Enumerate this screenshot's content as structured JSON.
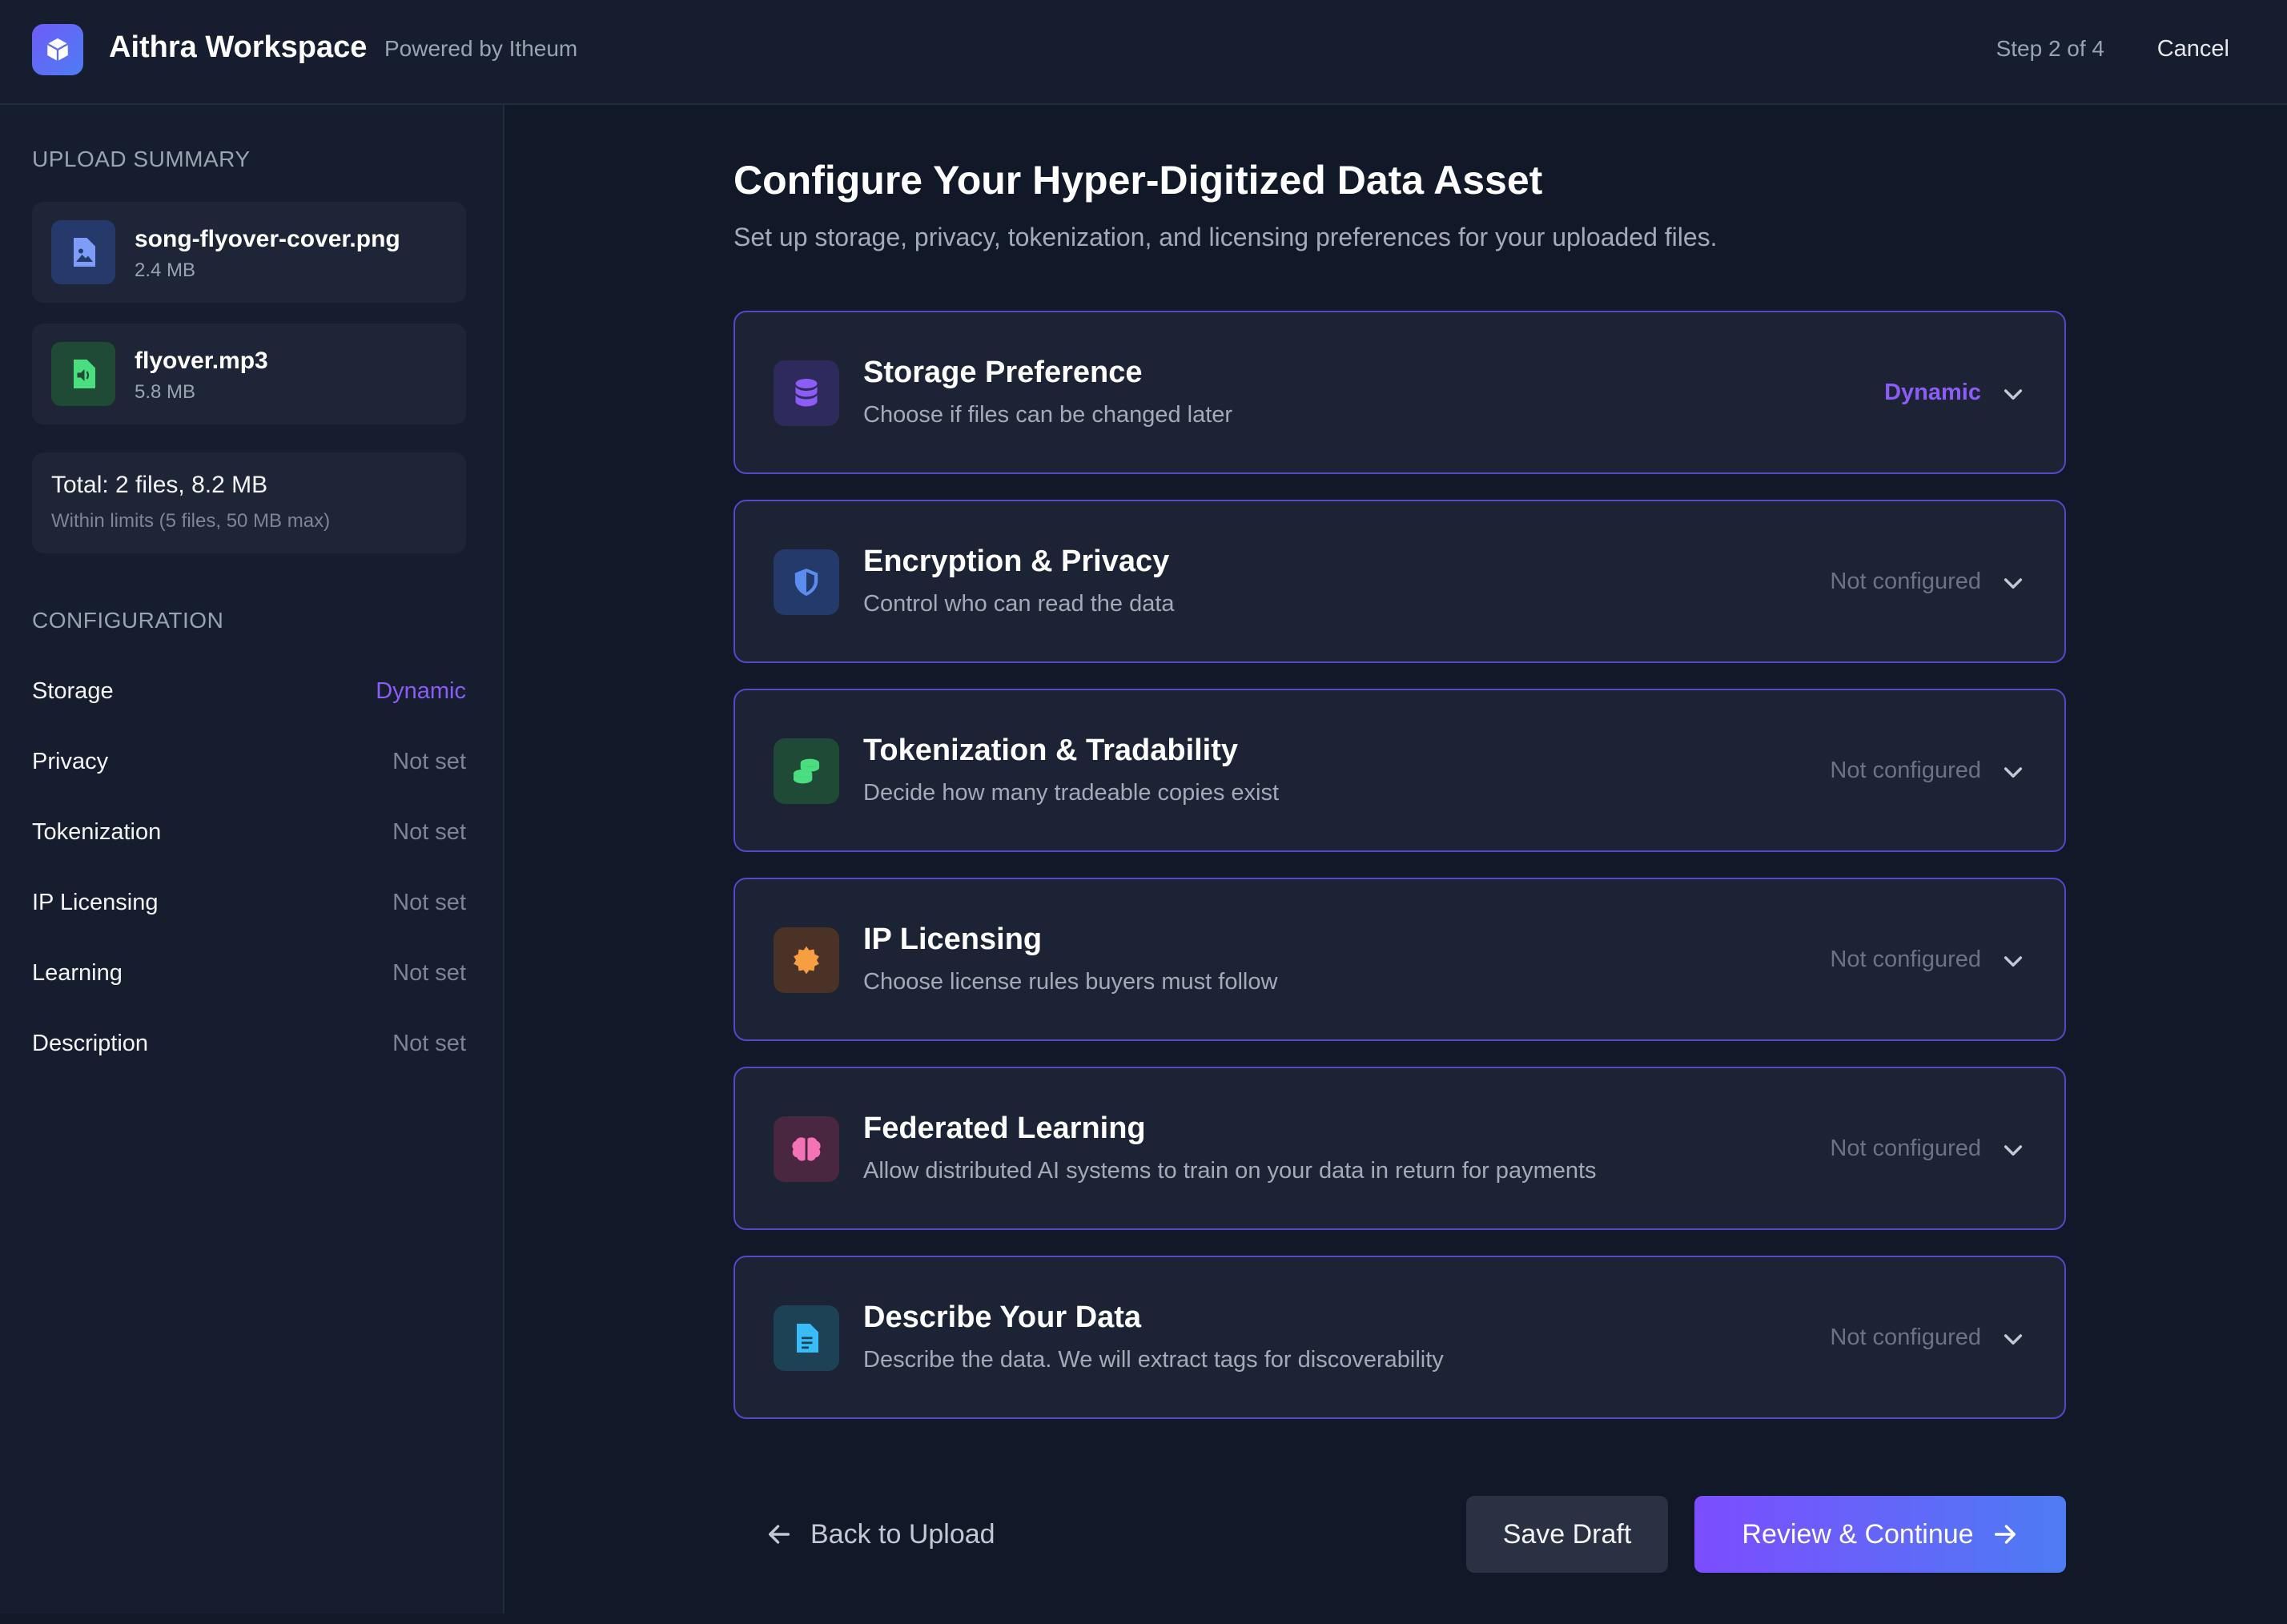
{
  "header": {
    "app_title": "Aithra Workspace",
    "powered_by": "Powered by Itheum",
    "step": "Step 2 of 4",
    "cancel_label": "Cancel",
    "logo_icon": "cube-icon"
  },
  "sidebar": {
    "upload_title": "UPLOAD SUMMARY",
    "files": [
      {
        "name": "song-flyover-cover.png",
        "size": "2.4 MB",
        "icon": "image-file-icon",
        "color": "#6f8cf6"
      },
      {
        "name": "flyover.mp3",
        "size": "5.8 MB",
        "icon": "audio-file-icon",
        "color": "#4ade80"
      }
    ],
    "total": "Total: 2 files, 8.2 MB",
    "limits": "Within limits (5 files, 50 MB max)",
    "config_title": "CONFIGURATION",
    "config": [
      {
        "label": "Storage",
        "value": "Dynamic"
      },
      {
        "label": "Privacy",
        "value": "Not set"
      },
      {
        "label": "Tokenization",
        "value": "Not set"
      },
      {
        "label": "IP Licensing",
        "value": "Not set"
      },
      {
        "label": "Learning",
        "value": "Not set"
      },
      {
        "label": "Description",
        "value": "Not set"
      }
    ]
  },
  "main": {
    "title": "Configure Your Hyper-Digitized Data Asset",
    "subtitle": "Set up storage, privacy, tokenization, and licensing preferences for your uploaded files.",
    "cards": [
      {
        "title": "Storage Preference",
        "desc": "Choose if files can be changed later",
        "status": "Dynamic",
        "icon": "database-icon",
        "color": "#8b5cf6"
      },
      {
        "title": "Encryption & Privacy",
        "desc": "Control who can read the data",
        "status": "Not configured",
        "icon": "shield-icon",
        "color": "#5b8def"
      },
      {
        "title": "Tokenization & Tradability",
        "desc": "Decide how many tradeable copies exist",
        "status": "Not configured",
        "icon": "coins-icon",
        "color": "#4ade80"
      },
      {
        "title": "IP Licensing",
        "desc": "Choose license rules buyers must follow",
        "status": "Not configured",
        "icon": "certificate-icon",
        "color": "#f59e42"
      },
      {
        "title": "Federated Learning",
        "desc": "Allow distributed AI systems to train on your data in return for payments",
        "status": "Not configured",
        "icon": "brain-icon",
        "color": "#f472b6"
      },
      {
        "title": "Describe Your Data",
        "desc": "Describe the data. We will extract tags for discoverability",
        "status": "Not configured",
        "icon": "document-icon",
        "color": "#38bdf8"
      }
    ]
  },
  "footer": {
    "back_label": "Back to Upload",
    "save_label": "Save Draft",
    "continue_label": "Review & Continue"
  },
  "colors": {
    "accent": "#8b5cf6",
    "background": "#111827",
    "card_border": "#5548c8"
  }
}
